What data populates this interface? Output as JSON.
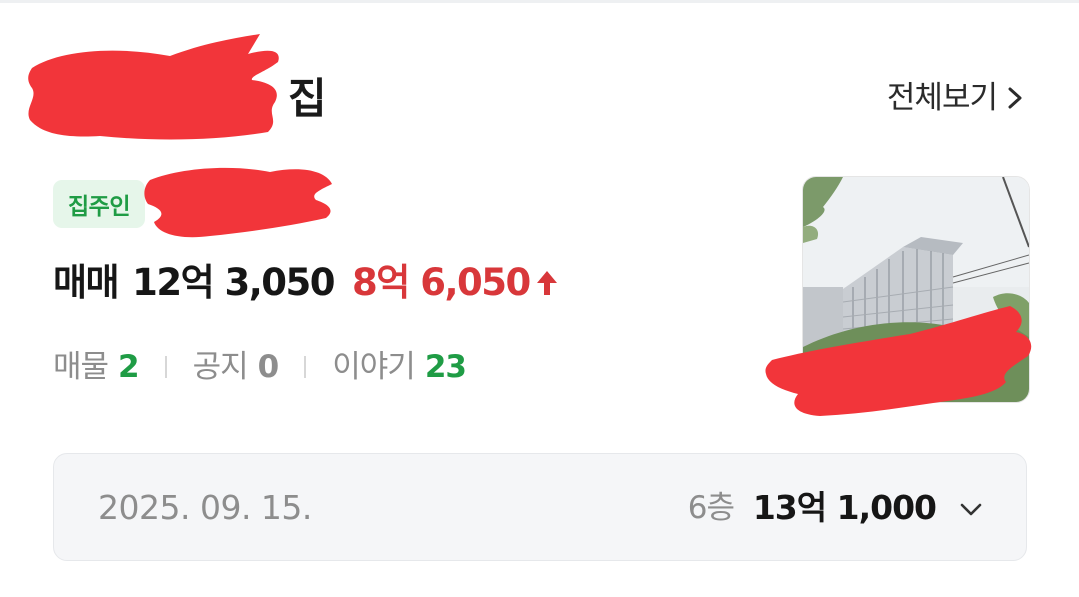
{
  "header": {
    "title_suffix": "집",
    "view_all_label": "전체보기",
    "view_all_icon": "chevron-right-icon"
  },
  "owner": {
    "badge_label": "집주인"
  },
  "price": {
    "type_label": "매매",
    "value": "12억 3,050",
    "change": "8억 6,050",
    "change_icon": "arrow-up-icon",
    "change_color": "#d8373a"
  },
  "stats": [
    {
      "label": "매물",
      "value": "2"
    },
    {
      "label": "공지",
      "value": "0"
    },
    {
      "label": "이야기",
      "value": "23"
    }
  ],
  "latest_deal": {
    "date": "2025. 09. 15.",
    "floor": "6층",
    "price": "13억 1,000",
    "expand_icon": "chevron-down-icon"
  },
  "colors": {
    "accent_green": "#1f9c45",
    "badge_bg": "#e6f6ea",
    "redaction": "#f2353a"
  }
}
